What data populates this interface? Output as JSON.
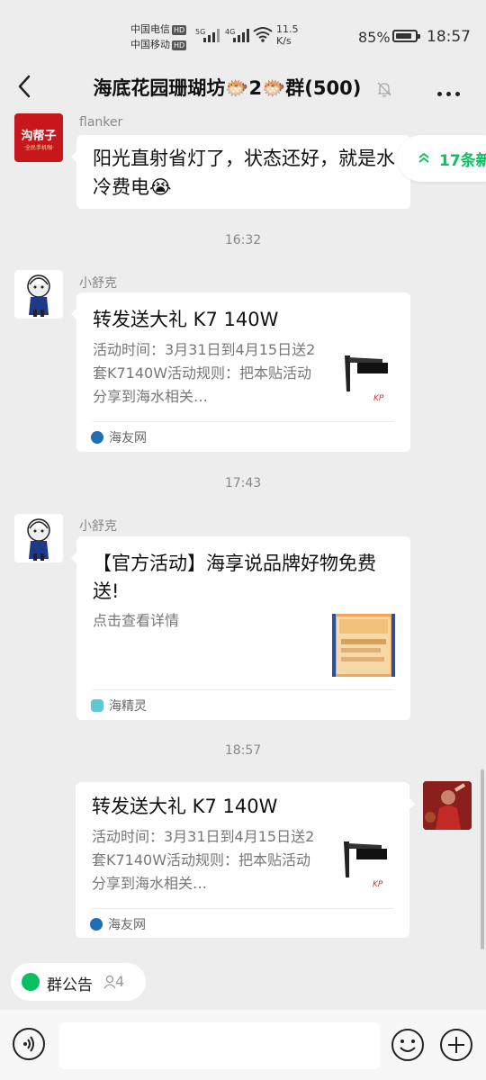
{
  "status_bar": {
    "carrier1": "中国电信",
    "carrier2": "中国移动",
    "hd": "HD",
    "net1": "5G",
    "net2": "4G",
    "speed_value": "11.5",
    "speed_unit": "K/s",
    "battery": "85%",
    "battery_level": 0.85,
    "time": "18:57"
  },
  "header": {
    "title": "海底花园珊瑚坊🐡2🐡群(500)",
    "back_icon": "chevron-left-icon",
    "mute_icon": "bell-off-icon",
    "more_icon": "more-icon"
  },
  "unread": {
    "label": "17条新"
  },
  "messages": {
    "m1": {
      "sender": "flanker",
      "avatar_text": "沟帮子",
      "avatar_sub": "·全民手机咖·",
      "text": "阳光直射省灯了，状态还好，就是水冷费电😭"
    },
    "t1": "16:32",
    "m2": {
      "sender": "小舒克",
      "title": "转发送大礼 K7 140W",
      "desc": "活动时间：3月31日到4月15日送2套K7140W活动规则：把本贴活动分享到海水相关…",
      "source": "海友网"
    },
    "t2": "17:43",
    "m3": {
      "sender": "小舒克",
      "title": "【官方活动】海享说品牌好物免费送!",
      "desc": "点击查看详情",
      "source": "海精灵"
    },
    "t3": "18:57",
    "m4": {
      "title": "转发送大礼 K7 140W",
      "desc": "活动时间：3月31日到4月15日送2套K7140W活动规则：把本贴活动分享到海水相关…",
      "source": "海友网"
    }
  },
  "bottom": {
    "notice_label": "群公告",
    "notice_count": "4"
  },
  "colors": {
    "accent": "#07c160",
    "background": "#ededed"
  }
}
